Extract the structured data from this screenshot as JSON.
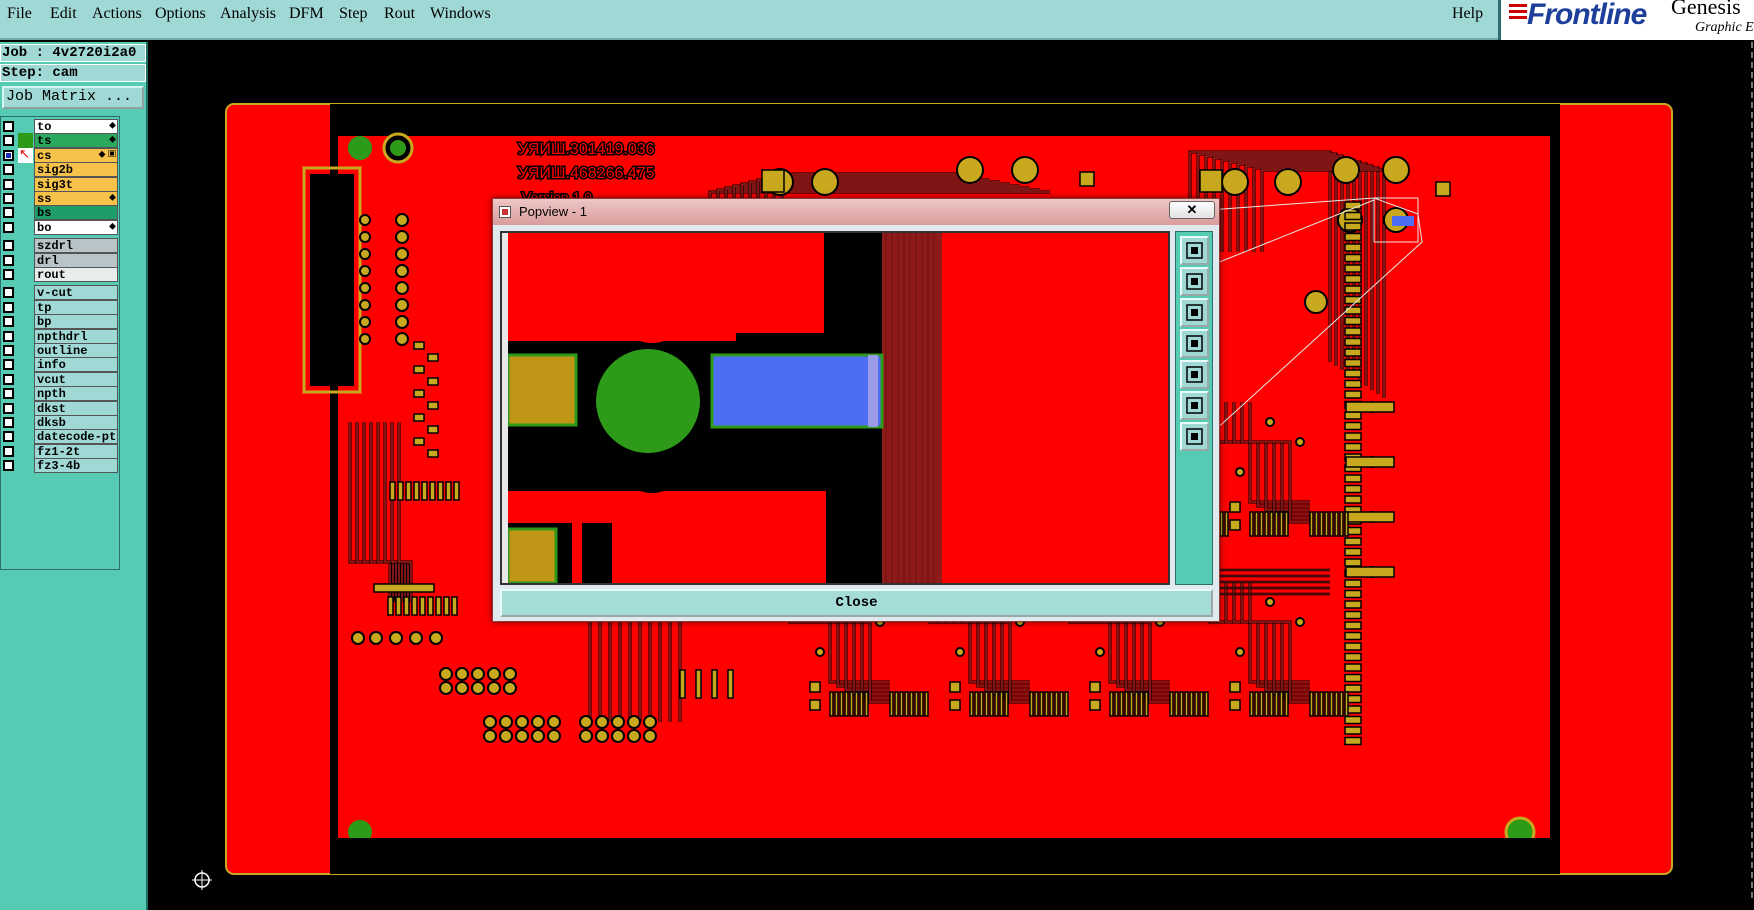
{
  "menu": {
    "items": [
      "File",
      "Edit",
      "Actions",
      "Options",
      "Analysis",
      "DFM",
      "Step",
      "Rout",
      "Windows"
    ],
    "help": "Help"
  },
  "brand": {
    "name": "Frontline",
    "product": "Genesis",
    "subtitle": "Graphic E"
  },
  "job": {
    "job_line": "Job : 4v2720i2a0",
    "step_line": "Step: cam",
    "matrix_button": "Job Matrix ..."
  },
  "layers": [
    {
      "name": "to",
      "color": "#ffffff",
      "checked": false,
      "flag": "⬥"
    },
    {
      "name": "ts",
      "color": "#2aa85e",
      "checked": false,
      "flag": "⬥"
    },
    {
      "name": "cs",
      "color": "#f7c24a",
      "checked": true,
      "flag": "⬥ ▣"
    },
    {
      "name": "sig2b",
      "color": "#f7c24a",
      "checked": false,
      "flag": ""
    },
    {
      "name": "sig3t",
      "color": "#f7c24a",
      "checked": false,
      "flag": ""
    },
    {
      "name": "ss",
      "color": "#f7c24a",
      "checked": false,
      "flag": "⬥"
    },
    {
      "name": "bs",
      "color": "#1e9c6a",
      "checked": false,
      "flag": ""
    },
    {
      "name": "bo",
      "color": "#ffffff",
      "checked": false,
      "flag": "⬥"
    },
    {
      "name": "szdrl",
      "color": "#b8c4c8",
      "checked": false,
      "flag": ""
    },
    {
      "name": "drl",
      "color": "#b8c4c8",
      "checked": false,
      "flag": ""
    },
    {
      "name": "rout",
      "color": "#e9ecec",
      "checked": false,
      "flag": ""
    },
    {
      "name": "v-cut",
      "color": "#9fd8d4",
      "checked": false,
      "flag": ""
    },
    {
      "name": "tp",
      "color": "#9fd8d4",
      "checked": false,
      "flag": ""
    },
    {
      "name": "bp",
      "color": "#9fd8d4",
      "checked": false,
      "flag": ""
    },
    {
      "name": "npthdrl",
      "color": "#9fd8d4",
      "checked": false,
      "flag": ""
    },
    {
      "name": "outline",
      "color": "#9fd8d4",
      "checked": false,
      "flag": ""
    },
    {
      "name": "info",
      "color": "#9fd8d4",
      "checked": false,
      "flag": ""
    },
    {
      "name": "vcut",
      "color": "#9fd8d4",
      "checked": false,
      "flag": ""
    },
    {
      "name": "npth",
      "color": "#9fd8d4",
      "checked": false,
      "flag": ""
    },
    {
      "name": "dkst",
      "color": "#9fd8d4",
      "checked": false,
      "flag": ""
    },
    {
      "name": "dksb",
      "color": "#9fd8d4",
      "checked": false,
      "flag": ""
    },
    {
      "name": "datecode-pt",
      "color": "#9fd8d4",
      "checked": false,
      "flag": ""
    },
    {
      "name": "fz1-2t",
      "color": "#9fd8d4",
      "checked": false,
      "flag": ""
    },
    {
      "name": "fz3-4b",
      "color": "#9fd8d4",
      "checked": false,
      "flag": ""
    }
  ],
  "board_text": {
    "line1": "УЯИШ.301419.036",
    "line2": "УЯИШ.468266.475",
    "line3": "Version 1.0"
  },
  "popview": {
    "title": "Popview - 1",
    "close_x": "✕",
    "close_button": "Close",
    "tools": [
      "zoom-home-icon",
      "pan-up-icon",
      "pan-down-icon",
      "pan-left-icon",
      "pan-right-icon",
      "zoom-fit-icon",
      "zoom-center-icon"
    ]
  },
  "colors": {
    "menubar": "#9fd8d4",
    "panel": "#55cbb3",
    "copper": "#ff0000",
    "pad": "#c8a81e",
    "via": "#2e9a1a",
    "highlight": "#4d6ef2"
  }
}
